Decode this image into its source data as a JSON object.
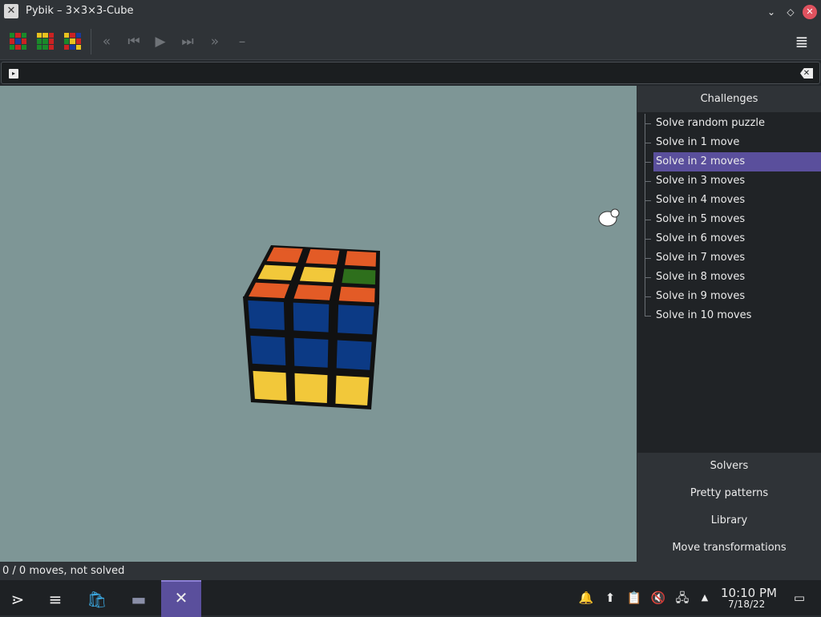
{
  "window": {
    "title": "Pybik – 3×3×3-Cube",
    "icon": "x-icon",
    "controls": {
      "minimize": "chevron-down-icon",
      "maximize": "diamond-icon",
      "close": "close-icon"
    }
  },
  "toolbar": {
    "buttons": [
      "new-random-cube-icon",
      "new-solved-cube-icon",
      "mixed-cube-icon",
      "rewind-icon",
      "previous-icon",
      "play-icon",
      "next-icon",
      "forward-icon",
      "mark-icon"
    ],
    "glyphs": {
      "rewind": "«",
      "previous": "⏮",
      "play": "▶",
      "next": "⏭",
      "forward": "»",
      "mark": "–",
      "menu": "≣"
    },
    "menu": "hamburger-menu-icon"
  },
  "editbar": {
    "value": "",
    "glyphs": {
      "edit": "▸",
      "clear": "✕"
    }
  },
  "cube_view": {
    "background_color": "#7e9696",
    "top_face": [
      [
        "#e35b26",
        "#e35b26",
        "#e35b26"
      ],
      [
        "#f2c83a",
        "#f2c83a",
        "#2e6f1c"
      ],
      [
        "#e35b26",
        "#e35b26",
        "#e35b26"
      ]
    ],
    "front_face": [
      [
        "#0c3a85",
        "#0c3a85",
        "#0c3a85"
      ],
      [
        "#0c3a85",
        "#0c3a85",
        "#0c3a85"
      ],
      [
        "#f2c83a",
        "#f2c83a",
        "#f2c83a"
      ]
    ]
  },
  "sidebar": {
    "challenges_header": "Challenges",
    "items": [
      {
        "label": "Solve random puzzle"
      },
      {
        "label": "Solve in 1 move"
      },
      {
        "label": "Solve in 2 moves",
        "selected": true
      },
      {
        "label": "Solve in 3 moves"
      },
      {
        "label": "Solve in 4 moves"
      },
      {
        "label": "Solve in 5 moves"
      },
      {
        "label": "Solve in 6 moves"
      },
      {
        "label": "Solve in 7 moves"
      },
      {
        "label": "Solve in 8 moves"
      },
      {
        "label": "Solve in 9 moves"
      },
      {
        "label": "Solve in 10 moves"
      }
    ],
    "tabs": [
      "Solvers",
      "Pretty patterns",
      "Library",
      "Move transformations"
    ],
    "accent_color": "#5a4f9c"
  },
  "status": {
    "text": "0 / 0 moves, not solved"
  },
  "taskbar": {
    "apps": [
      "app-launcher-icon",
      "system-settings-icon",
      "discover-store-icon",
      "file-manager-icon",
      "pybik-icon"
    ],
    "tray": [
      "notifications-icon",
      "updates-icon",
      "clipboard-icon",
      "volume-muted-icon",
      "network-icon",
      "show-hidden-icon"
    ],
    "glyphs": {
      "launcher": "⋗",
      "settings": "≡",
      "discover": "🛍",
      "files": "▬",
      "pybik": "✕",
      "notifications": "🔔",
      "updates": "⬆",
      "clipboard": "📋",
      "volume": "🔇",
      "network": "🖧",
      "expand": "▲",
      "desktop": "▭"
    },
    "clock_time": "10:10 PM",
    "clock_date": "7/18/22"
  }
}
